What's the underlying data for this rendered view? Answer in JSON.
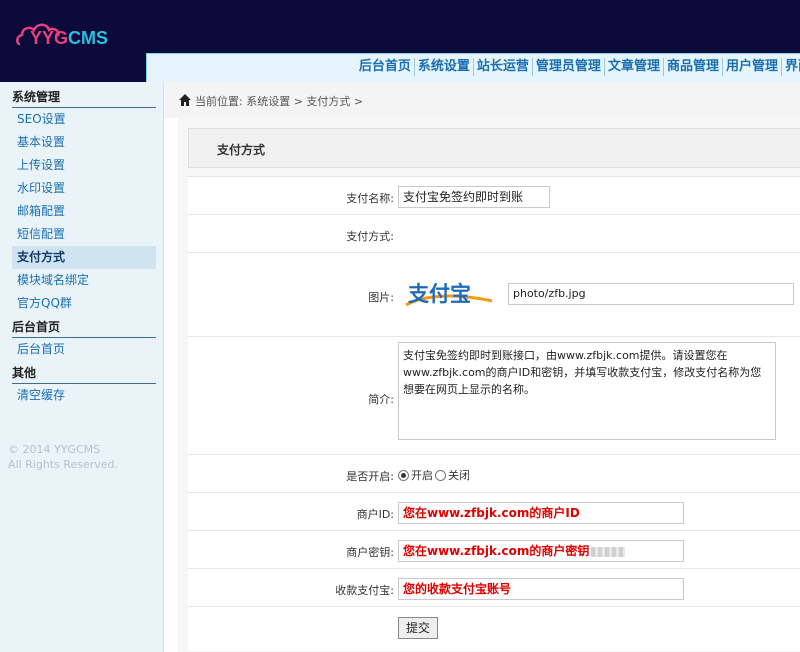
{
  "brand": {
    "logo_text": "YYGCMS",
    "pink": "#e8407a",
    "cyan": "#29c0e0"
  },
  "nav": {
    "items": [
      "后台首页",
      "系统设置",
      "站长运营",
      "管理员管理",
      "文章管理",
      "商品管理",
      "用户管理",
      "界面"
    ]
  },
  "sidebar": {
    "groups": [
      {
        "title": "系统管理",
        "items": [
          "SEO设置",
          "基本设置",
          "上传设置",
          "水印设置",
          "邮箱配置",
          "短信配置",
          "支付方式",
          "模块域名绑定",
          "官方QQ群"
        ]
      },
      {
        "title": "后台首页",
        "items": [
          "后台首页"
        ]
      },
      {
        "title": "其他",
        "items": [
          "清空缓存"
        ]
      }
    ],
    "active_item": "支付方式",
    "copyright_line1": "© 2014 YYGCMS",
    "copyright_line2": "All Rights Reserved."
  },
  "breadcrumb": {
    "text": "当前位置: 系统设置 > 支付方式 >"
  },
  "panel": {
    "title": "支付方式"
  },
  "form": {
    "name_label": "支付名称:",
    "name_value": "支付宝免签约即时到账",
    "method_label": "支付方式:",
    "image_label": "图片:",
    "logo_text": "支付宝",
    "image_path": "photo/zfb.jpg",
    "intro_label": "简介:",
    "intro_text": "支付宝免签约即时到账接口，由www.zfbjk.com提供。请设置您在www.zfbjk.com的商户ID和密钥，并填写收款支付宝，修改支付名称为您想要在网页上显示的名称。",
    "enable_label": "是否开启:",
    "enable_on": "开启",
    "enable_off": "关闭",
    "enabled": true,
    "merchant_id_label": "商户ID:",
    "merchant_id_value": "您在www.zfbjk.com的商户ID",
    "merchant_key_label": "商户密钥:",
    "merchant_key_value": "您在www.zfbjk.com的商户密钥",
    "alipay_account_label": "收款支付宝:",
    "alipay_account_value": "您的收款支付宝账号",
    "submit_label": "提交"
  }
}
